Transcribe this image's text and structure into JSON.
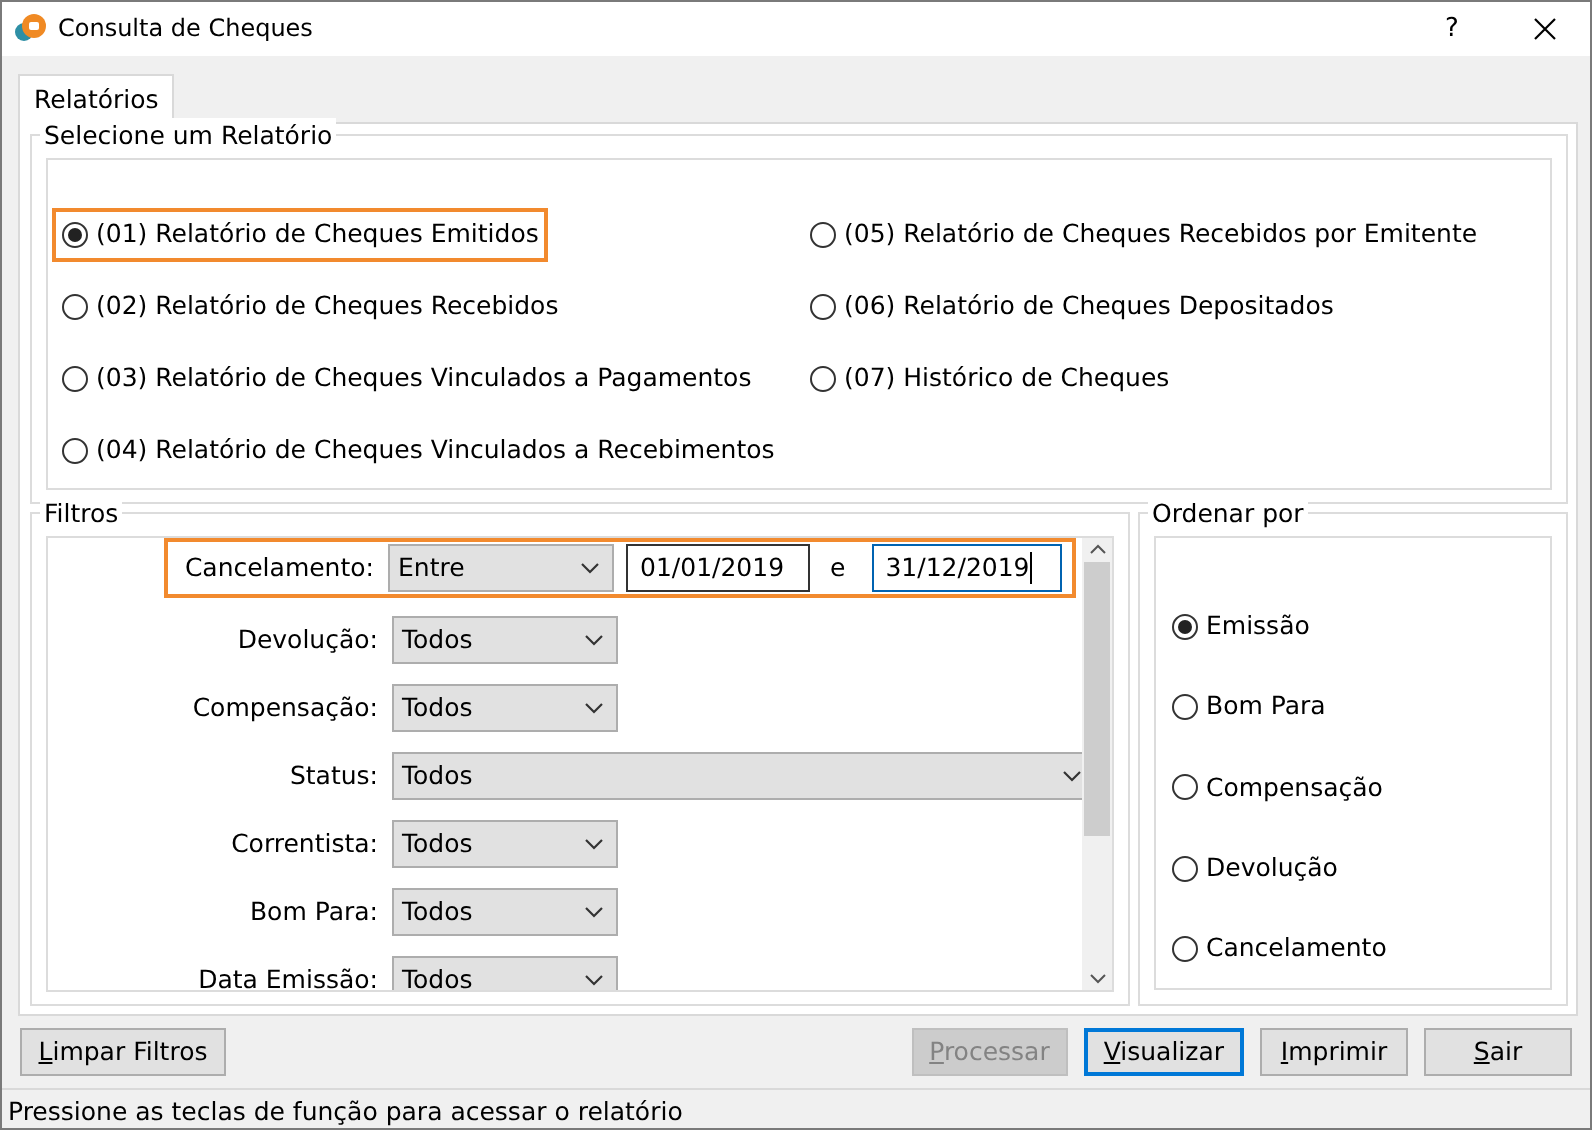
{
  "window": {
    "title": "Consulta de Cheques",
    "help": "?"
  },
  "tabs": [
    {
      "label": "Relatórios",
      "selected": true
    }
  ],
  "report_group": {
    "title": "Selecione um Relatório",
    "options": [
      {
        "label": "(01) Relatório de Cheques Emitidos",
        "selected": true,
        "highlighted": true
      },
      {
        "label": "(02) Relatório de Cheques Recebidos",
        "selected": false,
        "highlighted": false
      },
      {
        "label": "(03) Relatório de Cheques Vinculados a Pagamentos",
        "selected": false,
        "highlighted": false
      },
      {
        "label": "(04) Relatório de Cheques Vinculados a Recebimentos",
        "selected": false,
        "highlighted": false
      },
      {
        "label": "(05) Relatório de Cheques Recebidos por Emitente",
        "selected": false,
        "highlighted": false
      },
      {
        "label": "(06) Relatório de Cheques Depositados",
        "selected": false,
        "highlighted": false
      },
      {
        "label": "(07) Histórico de Cheques",
        "selected": false,
        "highlighted": false
      }
    ]
  },
  "filters": {
    "title": "Filtros",
    "rows": [
      {
        "kind": "range",
        "label": "Cancelamento:",
        "value": "Entre",
        "highlighted": true,
        "from": {
          "value": "01/01/2019",
          "focused": false
        },
        "joiner": "e",
        "to": {
          "value": "31/12/2019",
          "focused": true
        }
      },
      {
        "kind": "short",
        "label": "Devolução:",
        "value": "Todos",
        "highlighted": false
      },
      {
        "kind": "short",
        "label": "Compensação:",
        "value": "Todos",
        "highlighted": false
      },
      {
        "kind": "long",
        "label": "Status:",
        "value": "Todos",
        "highlighted": false
      },
      {
        "kind": "short",
        "label": "Correntista:",
        "value": "Todos",
        "highlighted": false
      },
      {
        "kind": "short",
        "label": "Bom Para:",
        "value": "Todos",
        "highlighted": false
      },
      {
        "kind": "short",
        "label": "Data Emissão:",
        "value": "Todos",
        "highlighted": false
      }
    ]
  },
  "order": {
    "title": "Ordenar por",
    "options": [
      {
        "label": "Emissão",
        "selected": true
      },
      {
        "label": "Bom Para",
        "selected": false
      },
      {
        "label": "Compensação",
        "selected": false
      },
      {
        "label": "Devolução",
        "selected": false
      },
      {
        "label": "Cancelamento",
        "selected": false
      }
    ]
  },
  "buttons": [
    {
      "label": "Limpar Filtros",
      "disabled": false,
      "focused": false
    },
    {
      "label": "Processar",
      "disabled": true,
      "focused": false
    },
    {
      "label": "Visualizar",
      "disabled": false,
      "focused": true
    },
    {
      "label": "Imprimir",
      "disabled": false,
      "focused": false
    },
    {
      "label": "Sair",
      "disabled": false,
      "focused": false
    }
  ],
  "status_bar": "Pressione as teclas de função para acessar o relatório"
}
